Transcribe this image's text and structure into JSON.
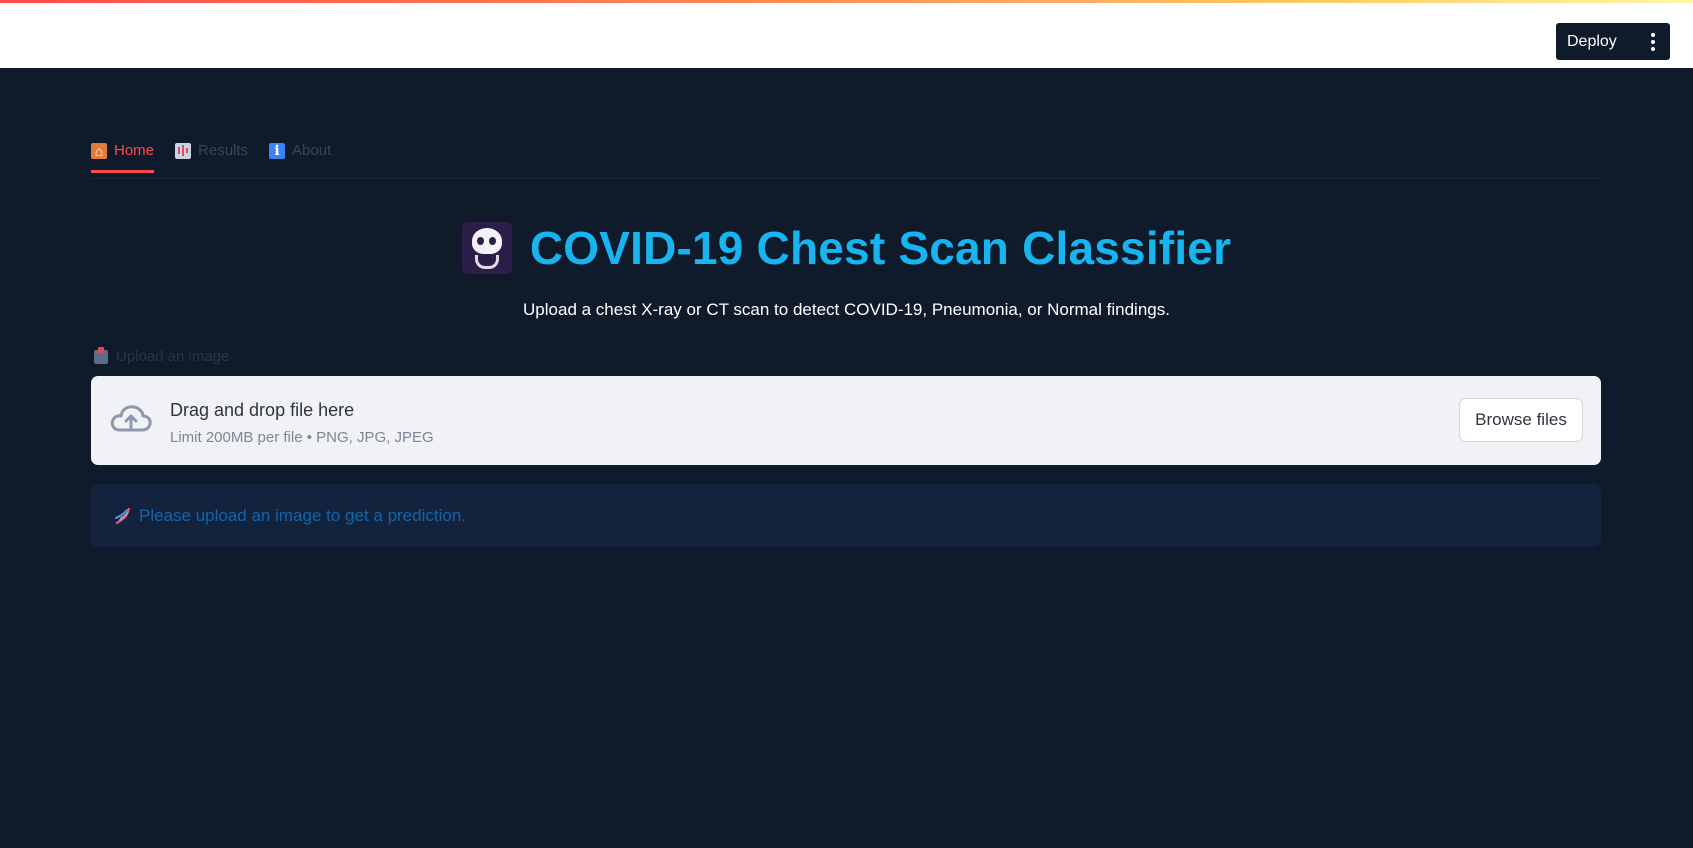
{
  "header": {
    "deploy_label": "Deploy",
    "menu_icon": "kebab-vertical-icon"
  },
  "tabs": [
    {
      "label": "Home",
      "icon": "house-icon",
      "active": true
    },
    {
      "label": "Results",
      "icon": "bar-chart-icon",
      "active": false
    },
    {
      "label": "About",
      "icon": "info-icon",
      "active": false
    }
  ],
  "main": {
    "title": "COVID-19 Chest Scan Classifier",
    "title_icon": "xray-skull-icon",
    "subtitle": "Upload a chest X-ray or CT scan to detect COVID-19, Pneumonia, or Normal findings.",
    "upload_label": "Upload an image",
    "upload_label_icon": "inbox-tray-icon"
  },
  "uploader": {
    "title": "Drag and drop file here",
    "limits": "Limit 200MB per file • PNG, JPG, JPEG",
    "browse_label": "Browse files",
    "icon": "cloud-upload-icon"
  },
  "info": {
    "message": "Please upload an image to get a prediction.",
    "icon": "dna-icon"
  },
  "colors": {
    "background": "#0f1a2b",
    "accent_red": "#ff4b4b",
    "title_blue": "#18b4f0",
    "info_text": "#1464a8"
  }
}
